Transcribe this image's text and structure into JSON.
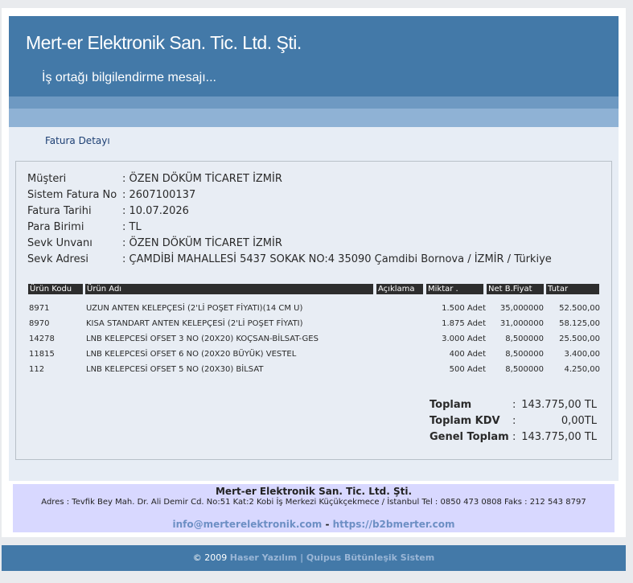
{
  "header": {
    "title": "Mert-er Elektronik San. Tic. Ltd. Şti.",
    "subtitle": "İş ortağı bilgilendirme mesajı..."
  },
  "section_title": "Fatura Detayı",
  "invoice": {
    "fields": [
      {
        "label": "Müşteri",
        "value": ": ÖZEN DÖKÜM TİCARET İZMİR"
      },
      {
        "label": "Sistem Fatura No",
        "value": ": 2607100137"
      },
      {
        "label": "Fatura Tarihi",
        "value": ": 10.07.2026"
      },
      {
        "label": "Para Birimi",
        "value": ": TL"
      },
      {
        "label": "Sevk Unvanı",
        "value": ": ÖZEN DÖKÜM TİCARET İZMİR"
      },
      {
        "label": "Sevk Adresi",
        "value": ": ÇAMDİBİ MAHALLESİ 5437 SOKAK NO:4 35090 Çamdibi Bornova / İZMİR / Türkiye"
      }
    ]
  },
  "table": {
    "headers": [
      "Ürün Kodu",
      "Ürün Adı",
      "Açıklama",
      "Miktar .",
      "Net B.Fiyat",
      "Tutar"
    ],
    "rows": [
      {
        "code": "8971",
        "name": "UZUN ANTEN KELEPÇESİ (2'Lİ POŞET FİYATI)(14 CM U)",
        "qty": "1.500 Adet",
        "price": "35,000000",
        "total": "52.500,00"
      },
      {
        "code": "8970",
        "name": "KISA STANDART ANTEN KELEPÇESİ (2'Lİ POŞET FİYATI)",
        "qty": "1.875 Adet",
        "price": "31,000000",
        "total": "58.125,00"
      },
      {
        "code": "14278",
        "name": "LNB KELEPCESİ OFSET 3 NO (20X20) KOÇSAN-BİLSAT-GES",
        "qty": "3.000 Adet",
        "price": "8,500000",
        "total": "25.500,00"
      },
      {
        "code": "11815",
        "name": "LNB KELEPCESİ OFSET 6 NO (20X20 BÜYÜK) VESTEL",
        "qty": "400 Adet",
        "price": "8,500000",
        "total": "3.400,00"
      },
      {
        "code": "112",
        "name": "LNB KELEPCESİ OFSET 5 NO (20X30) BİLSAT",
        "qty": "500 Adet",
        "price": "8,500000",
        "total": "4.250,00"
      }
    ]
  },
  "totals": [
    {
      "label": "Toplam",
      "colon": ":",
      "value": "143.775,00 TL"
    },
    {
      "label": "Toplam KDV",
      "colon": ":",
      "value": "0,00TL"
    },
    {
      "label": "Genel Toplam",
      "colon": ":",
      "value": "143.775,00 TL"
    }
  ],
  "footer": {
    "company": "Mert-er Elektronik San. Tic. Ltd. Şti.",
    "address": "Adres : Tevfik Bey Mah. Dr. Ali Demir Cd. No:51 Kat:2 Kobi İş Merkezi Küçükçekmece / İstanbul Tel : 0850 473 0808 Faks : 212 543 8797",
    "email": "info@merterelektronik.com",
    "separator": " - ",
    "website": "https://b2bmerter.com"
  },
  "bottom": {
    "copyright": "© 2009 ",
    "link1": "Haser Yazılım",
    "separator": " | ",
    "link2": "Quipus Bütünleşik Sistem"
  },
  "colors": {
    "header_bg": "#4379a8",
    "band_dark": "#6e99c2",
    "band_light": "#8fb2d5",
    "table_header": "#2d2d2d",
    "footer_bg": "#d8d8ff",
    "link": "#6d8fc4"
  }
}
